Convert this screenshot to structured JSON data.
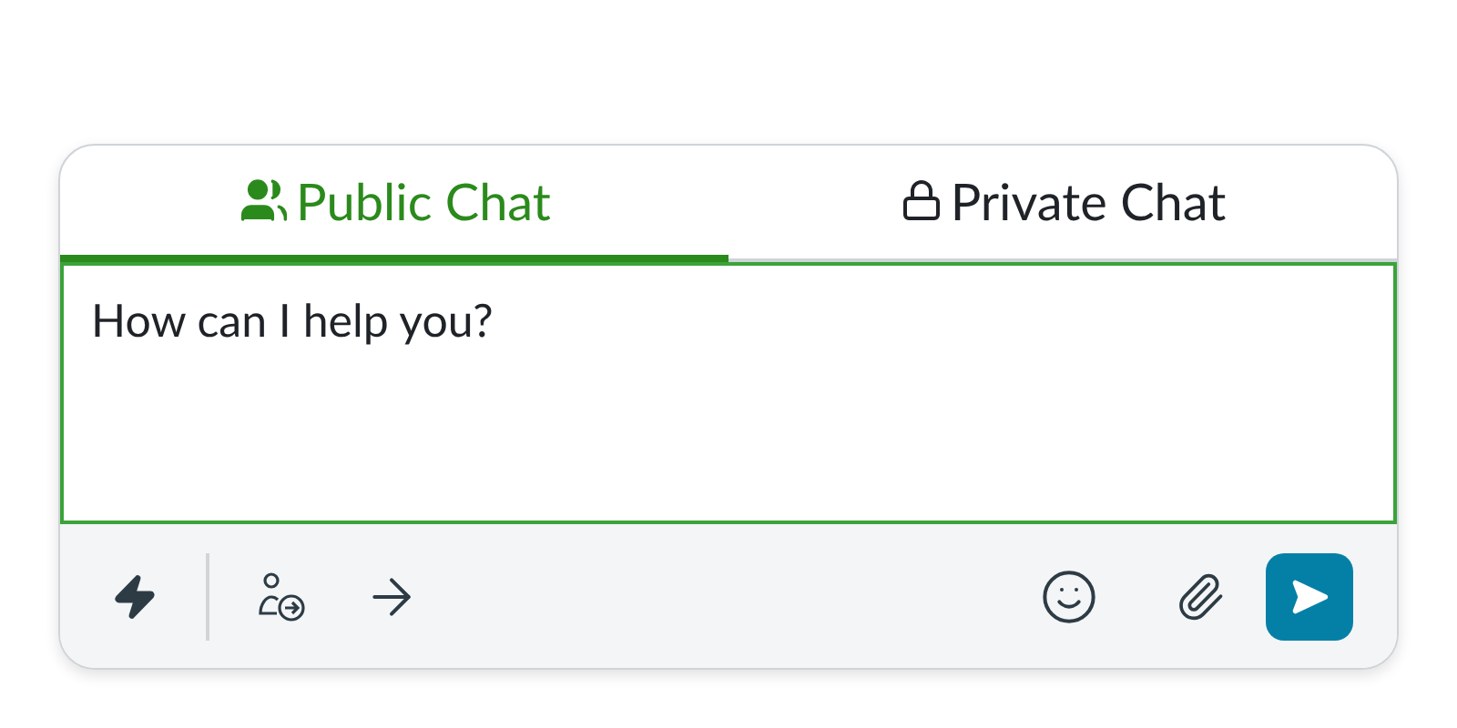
{
  "tabs": [
    {
      "label": "Public Chat",
      "selected": true
    },
    {
      "label": "Private Chat",
      "selected": false
    }
  ],
  "message": {
    "value": "How can I help you?"
  }
}
